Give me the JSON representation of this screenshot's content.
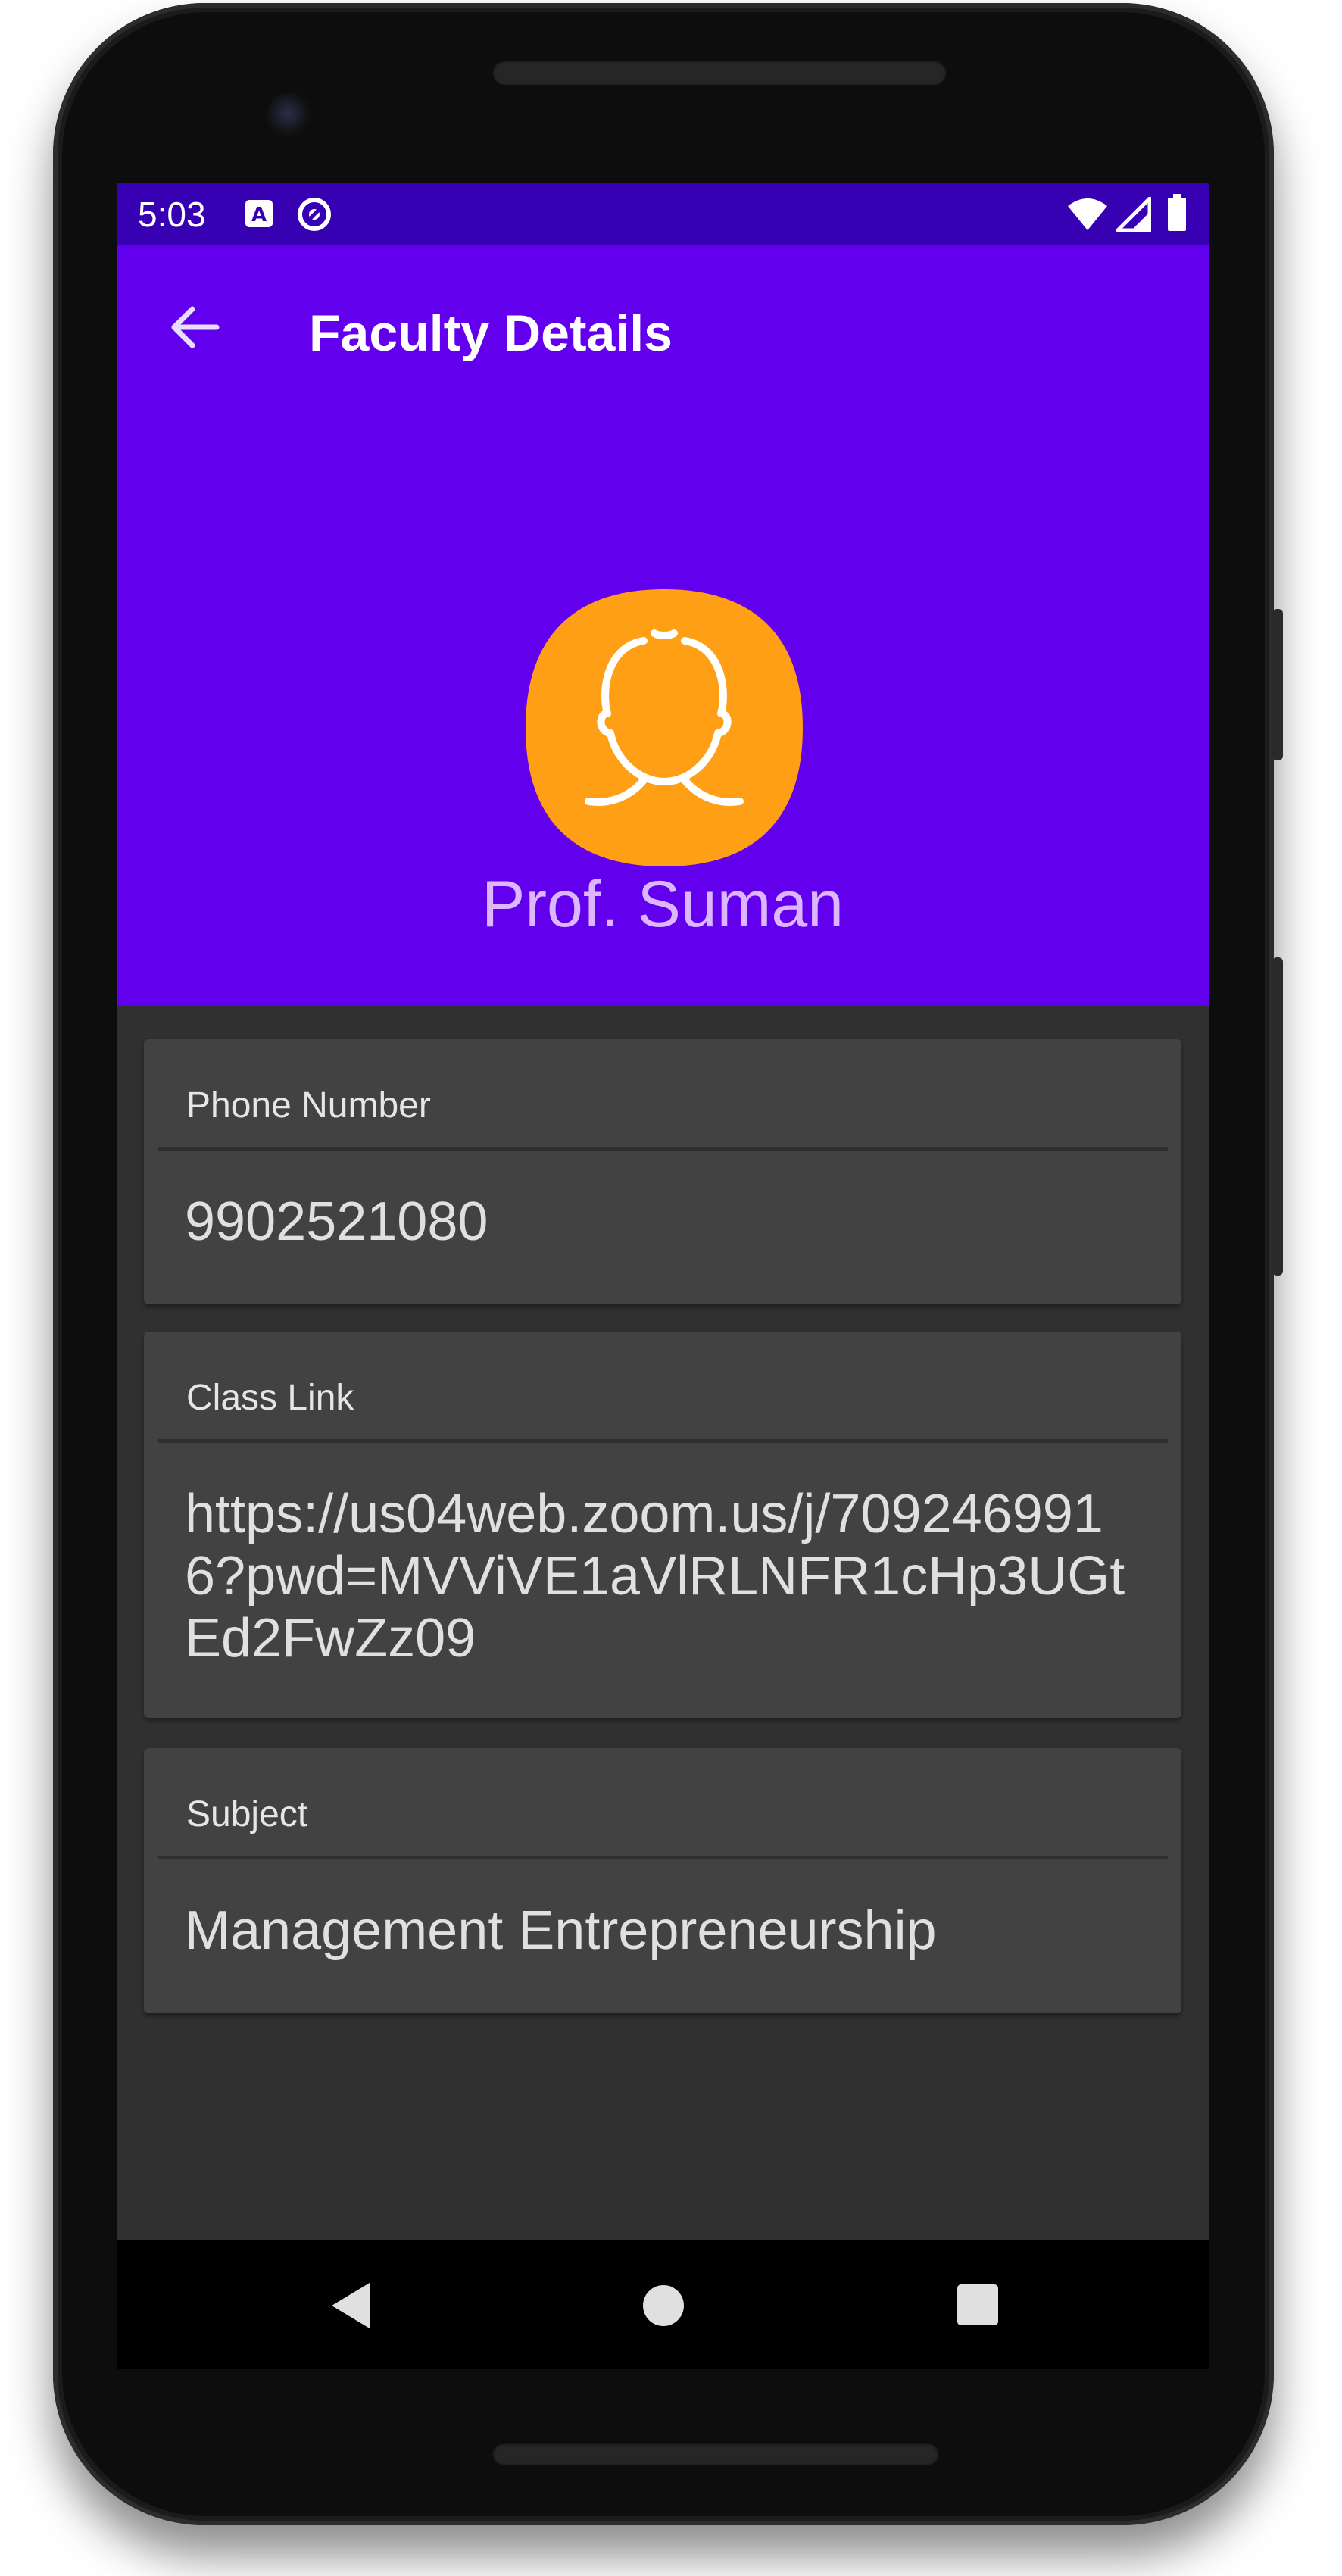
{
  "status_bar": {
    "time": "5:03",
    "color": "#3700b3",
    "icons": [
      "accessibility-a-icon",
      "sync-icon",
      "wifi-icon",
      "cellular-signal-icon",
      "battery-icon"
    ]
  },
  "app_bar": {
    "title": "Faculty Details",
    "color": "#6200ee",
    "back_icon": "arrow-back-icon"
  },
  "profile": {
    "avatar_icon": "person-outline-icon",
    "avatar_color": "#ff9f16",
    "name": "Prof. Suman"
  },
  "details": [
    {
      "label": "Phone Number",
      "value": "9902521080"
    },
    {
      "label": "Class Link",
      "value": "https://us04web.zoom.us/j/7092469916?pwd=MVViVE1aVlRLNFR1cHp3UGtEd2FwZz09"
    },
    {
      "label": "Subject",
      "value": "Management Entrepreneurship"
    }
  ],
  "nav_bar": {
    "icons": [
      "back-triangle-icon",
      "home-circle-icon",
      "recents-square-icon"
    ]
  }
}
